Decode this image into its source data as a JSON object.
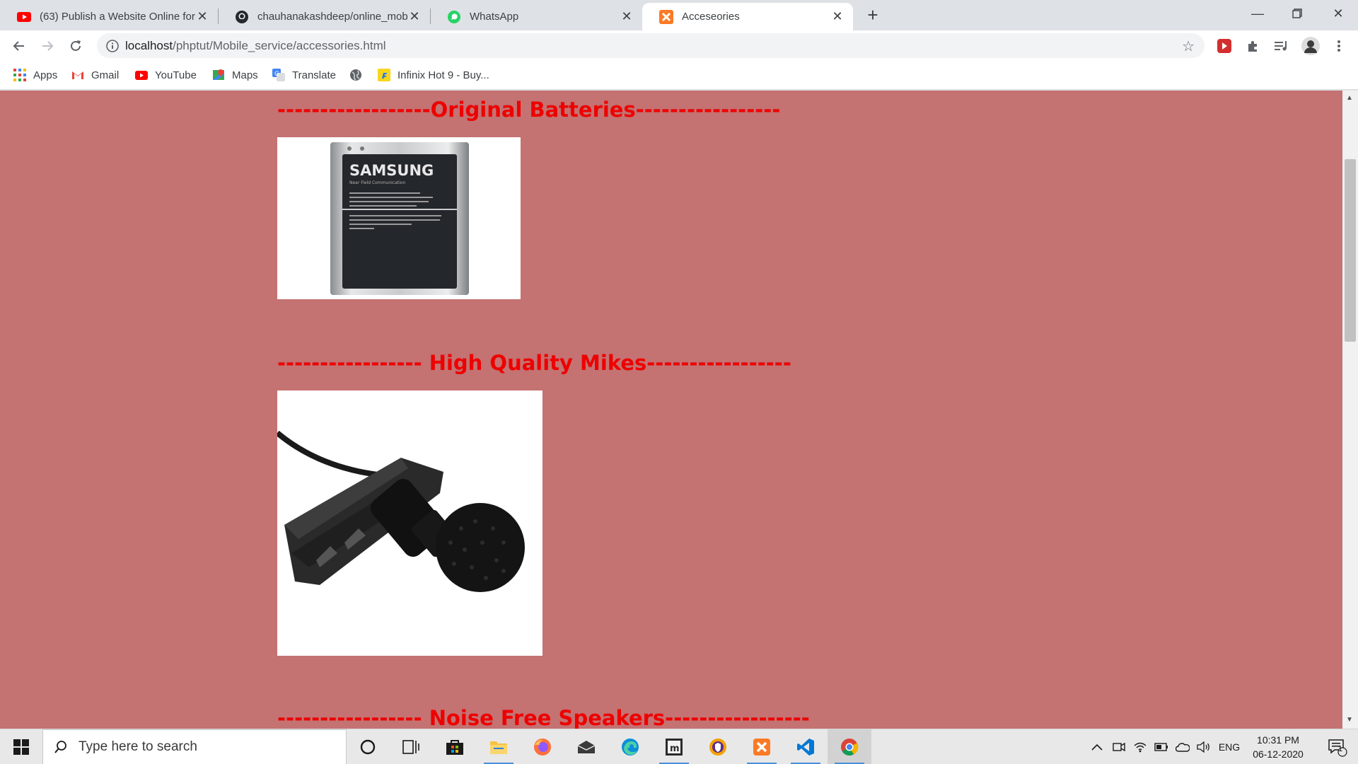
{
  "browser": {
    "tabs": [
      {
        "title": "(63) Publish a Website Online for",
        "icon": "youtube-icon"
      },
      {
        "title": "chauhanakashdeep/online_mobil",
        "icon": "github-icon"
      },
      {
        "title": "WhatsApp",
        "icon": "whatsapp-icon"
      },
      {
        "title": "Acceseories",
        "icon": "xampp-icon",
        "active": true
      }
    ],
    "url_host": "localhost",
    "url_path": "/phptut/Mobile_service/accessories.html",
    "bookmarks": [
      {
        "label": "Apps",
        "icon": "apps-grid-icon"
      },
      {
        "label": "Gmail",
        "icon": "gmail-icon"
      },
      {
        "label": "YouTube",
        "icon": "youtube-icon"
      },
      {
        "label": "Maps",
        "icon": "maps-icon"
      },
      {
        "label": "Translate",
        "icon": "translate-icon"
      },
      {
        "label": "",
        "icon": "globe-icon"
      },
      {
        "label": "Infinix Hot 9 - Buy...",
        "icon": "flipkart-icon"
      }
    ]
  },
  "page": {
    "sections": [
      {
        "heading": "------------------Original Batteries-----------------",
        "image": "samsung-battery"
      },
      {
        "heading": "----------------- High Quality Mikes-----------------",
        "image": "lapel-microphone"
      },
      {
        "heading": "----------------- Noise Free Speakers-----------------",
        "image": ""
      }
    ],
    "battery_brand": "SAMSUNG",
    "battery_subtitle": "Near Field Communication"
  },
  "colors": {
    "page_background": "#c47272",
    "heading": "#ee0000"
  },
  "taskbar": {
    "search_placeholder": "Type here to search",
    "language": "ENG",
    "time": "10:31 PM",
    "date": "06-12-2020",
    "notification_count": "1"
  }
}
